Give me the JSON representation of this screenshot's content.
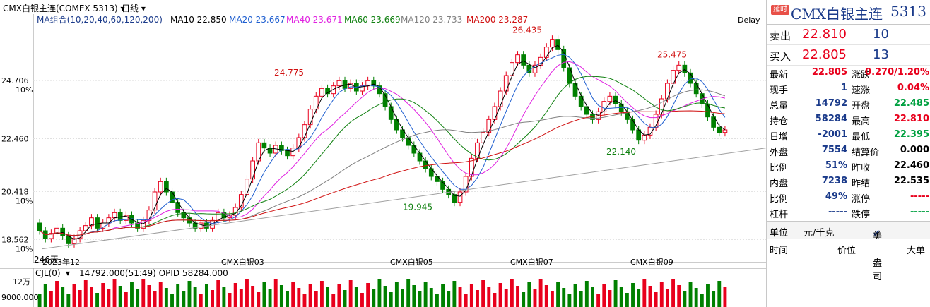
{
  "topbar": {
    "symbol": "CMX白银主连(COMEX 5313)",
    "period": "日线"
  },
  "ma": {
    "combo": "MA组合(10,20,40,60,120,200)",
    "items": [
      {
        "label": "MA10 22.850",
        "color": "#000000"
      },
      {
        "label": "MA20 23.667",
        "color": "#1f5fd0"
      },
      {
        "label": "MA40 23.671",
        "color": "#e020e0"
      },
      {
        "label": "MA60 23.669",
        "color": "#108010"
      },
      {
        "label": "MA120 23.733",
        "color": "#808080"
      },
      {
        "label": "MA200 23.287",
        "color": "#d01010"
      }
    ],
    "delay": "Delay"
  },
  "chart_data": {
    "type": "candlestick",
    "y_ticks": [
      {
        "value": "24.706",
        "pct": "10%"
      },
      {
        "value": "22.460",
        "pct": ""
      },
      {
        "value": "20.418",
        "pct": "10%"
      },
      {
        "value": "18.562",
        "pct": "10%"
      }
    ],
    "x_labels": [
      "2023年12",
      "CMX白银03",
      "CMX白银05",
      "CMX白银07",
      "CMX白银09"
    ],
    "annotations": [
      "24.775",
      "26.435",
      "25.475",
      "22.140",
      "19.945",
      "246天"
    ],
    "candles": [
      [
        19.2,
        18.9
      ],
      [
        18.9,
        18.6
      ],
      [
        18.6,
        18.8
      ],
      [
        18.8,
        19.0
      ],
      [
        19.0,
        18.7
      ],
      [
        18.7,
        18.4
      ],
      [
        18.4,
        18.6
      ],
      [
        18.6,
        18.9
      ],
      [
        18.9,
        19.1
      ],
      [
        19.1,
        19.4
      ],
      [
        19.4,
        19.0
      ],
      [
        19.0,
        19.2
      ],
      [
        19.2,
        19.4
      ],
      [
        19.4,
        19.6
      ],
      [
        19.6,
        19.3
      ],
      [
        19.3,
        19.5
      ],
      [
        19.5,
        19.2
      ],
      [
        19.2,
        19.0
      ],
      [
        19.0,
        19.3
      ],
      [
        19.3,
        19.7
      ],
      [
        19.7,
        20.4
      ],
      [
        20.4,
        20.8
      ],
      [
        20.8,
        20.4
      ],
      [
        20.4,
        20.0
      ],
      [
        20.0,
        19.6
      ],
      [
        19.6,
        19.4
      ],
      [
        19.4,
        19.2
      ],
      [
        19.2,
        19.0
      ],
      [
        19.0,
        19.2
      ],
      [
        19.2,
        19.0
      ],
      [
        19.0,
        19.3
      ],
      [
        19.3,
        19.6
      ],
      [
        19.6,
        19.4
      ],
      [
        19.4,
        19.5
      ],
      [
        19.5,
        19.8
      ],
      [
        19.8,
        20.3
      ],
      [
        20.3,
        20.9
      ],
      [
        20.9,
        21.6
      ],
      [
        21.6,
        22.3
      ],
      [
        22.3,
        22.1
      ],
      [
        22.1,
        21.9
      ],
      [
        21.9,
        22.2
      ],
      [
        22.2,
        22.0
      ],
      [
        22.0,
        21.8
      ],
      [
        21.8,
        22.1
      ],
      [
        22.1,
        22.5
      ],
      [
        22.5,
        23.0
      ],
      [
        23.0,
        23.6
      ],
      [
        23.6,
        24.1
      ],
      [
        24.1,
        24.4
      ],
      [
        24.4,
        24.2
      ],
      [
        24.2,
        24.5
      ],
      [
        24.5,
        24.7
      ],
      [
        24.7,
        24.4
      ],
      [
        24.4,
        24.6
      ],
      [
        24.6,
        24.3
      ],
      [
        24.3,
        24.5
      ],
      [
        24.5,
        24.7
      ],
      [
        24.7,
        24.5
      ],
      [
        24.5,
        24.2
      ],
      [
        24.2,
        23.7
      ],
      [
        23.7,
        23.2
      ],
      [
        23.2,
        22.8
      ],
      [
        22.8,
        22.5
      ],
      [
        22.5,
        22.2
      ],
      [
        22.2,
        21.9
      ],
      [
        21.9,
        21.6
      ],
      [
        21.6,
        21.3
      ],
      [
        21.3,
        21.0
      ],
      [
        21.0,
        20.8
      ],
      [
        20.8,
        20.5
      ],
      [
        20.5,
        20.3
      ],
      [
        20.3,
        20.0
      ],
      [
        20.0,
        20.4
      ],
      [
        20.4,
        21.0
      ],
      [
        21.0,
        21.7
      ],
      [
        21.7,
        22.3
      ],
      [
        22.3,
        22.7
      ],
      [
        22.7,
        23.2
      ],
      [
        23.2,
        23.7
      ],
      [
        23.7,
        24.3
      ],
      [
        24.3,
        24.9
      ],
      [
        24.9,
        25.4
      ],
      [
        25.4,
        25.7
      ],
      [
        25.7,
        25.3
      ],
      [
        25.3,
        25.0
      ],
      [
        25.0,
        25.3
      ],
      [
        25.3,
        25.6
      ],
      [
        25.6,
        26.0
      ],
      [
        26.0,
        26.3
      ],
      [
        26.3,
        25.9
      ],
      [
        25.9,
        25.2
      ],
      [
        25.2,
        24.6
      ],
      [
        24.6,
        24.1
      ],
      [
        24.1,
        23.7
      ],
      [
        23.7,
        23.4
      ],
      [
        23.4,
        23.2
      ],
      [
        23.2,
        23.5
      ],
      [
        23.5,
        23.9
      ],
      [
        23.9,
        24.1
      ],
      [
        24.1,
        23.8
      ],
      [
        23.8,
        23.5
      ],
      [
        23.5,
        23.2
      ],
      [
        23.2,
        22.8
      ],
      [
        22.8,
        22.4
      ],
      [
        22.4,
        22.6
      ],
      [
        22.6,
        22.9
      ],
      [
        22.9,
        23.4
      ],
      [
        23.4,
        24.0
      ],
      [
        24.0,
        24.6
      ],
      [
        24.6,
        25.1
      ],
      [
        25.1,
        25.3
      ],
      [
        25.3,
        25.0
      ],
      [
        25.0,
        24.6
      ],
      [
        24.6,
        24.2
      ],
      [
        24.2,
        23.8
      ],
      [
        23.8,
        23.3
      ],
      [
        23.3,
        22.9
      ],
      [
        22.9,
        22.7
      ],
      [
        22.7,
        22.8
      ]
    ],
    "volume_label": "CJL(0)",
    "volume_info": "14792.000(51:49)  OPID 58284.000",
    "volume_ticks": [
      "12万",
      "9000.000"
    ]
  },
  "panel": {
    "delay_badge": "延时",
    "title": "CMX白银主连",
    "code": "5313",
    "sell": {
      "label": "卖出",
      "price": "22.810",
      "vol": "10"
    },
    "buy": {
      "label": "买入",
      "price": "22.805",
      "vol": "13"
    },
    "rows": [
      {
        "l1": "最新",
        "v1": "22.805",
        "c1": "red",
        "l2": "涨跌",
        "v2": "0.270/1.20%",
        "c2": "red"
      },
      {
        "l1": "现手",
        "v1": "1",
        "c1": "blue",
        "l2": "速涨",
        "v2": "0.04%",
        "c2": "red"
      },
      {
        "l1": "总量",
        "v1": "14792",
        "c1": "blue",
        "l2": "开盘",
        "v2": "22.485",
        "c2": "green"
      },
      {
        "l1": "持仓",
        "v1": "58284",
        "c1": "blue",
        "l2": "最高",
        "v2": "22.810",
        "c2": "red"
      },
      {
        "l1": "日增",
        "v1": "-2001",
        "c1": "blue",
        "l2": "最低",
        "v2": "22.395",
        "c2": "green"
      },
      {
        "l1": "外盘",
        "v1": "7554",
        "c1": "blue",
        "l2": "结算价",
        "v2": "0.000",
        "c2": ""
      },
      {
        "l1": "比例",
        "v1": "51%",
        "c1": "blue",
        "l2": "昨收",
        "v2": "22.460",
        "c2": ""
      },
      {
        "l1": "内盘",
        "v1": "7238",
        "c1": "blue",
        "l2": "昨结",
        "v2": "22.535",
        "c2": ""
      },
      {
        "l1": "比例",
        "v1": "49%",
        "c1": "blue",
        "l2": "涨停",
        "v2": "-----",
        "c2": "red"
      },
      {
        "l1": "杠杆",
        "v1": "-----",
        "c1": "blue",
        "l2": "跌停",
        "v2": "-----",
        "c2": "green"
      }
    ],
    "unit_label": "单位",
    "unit_value": "元/千克",
    "currency": "美元/盎司",
    "trade_cols": [
      "时间",
      "价位",
      "大单"
    ]
  }
}
